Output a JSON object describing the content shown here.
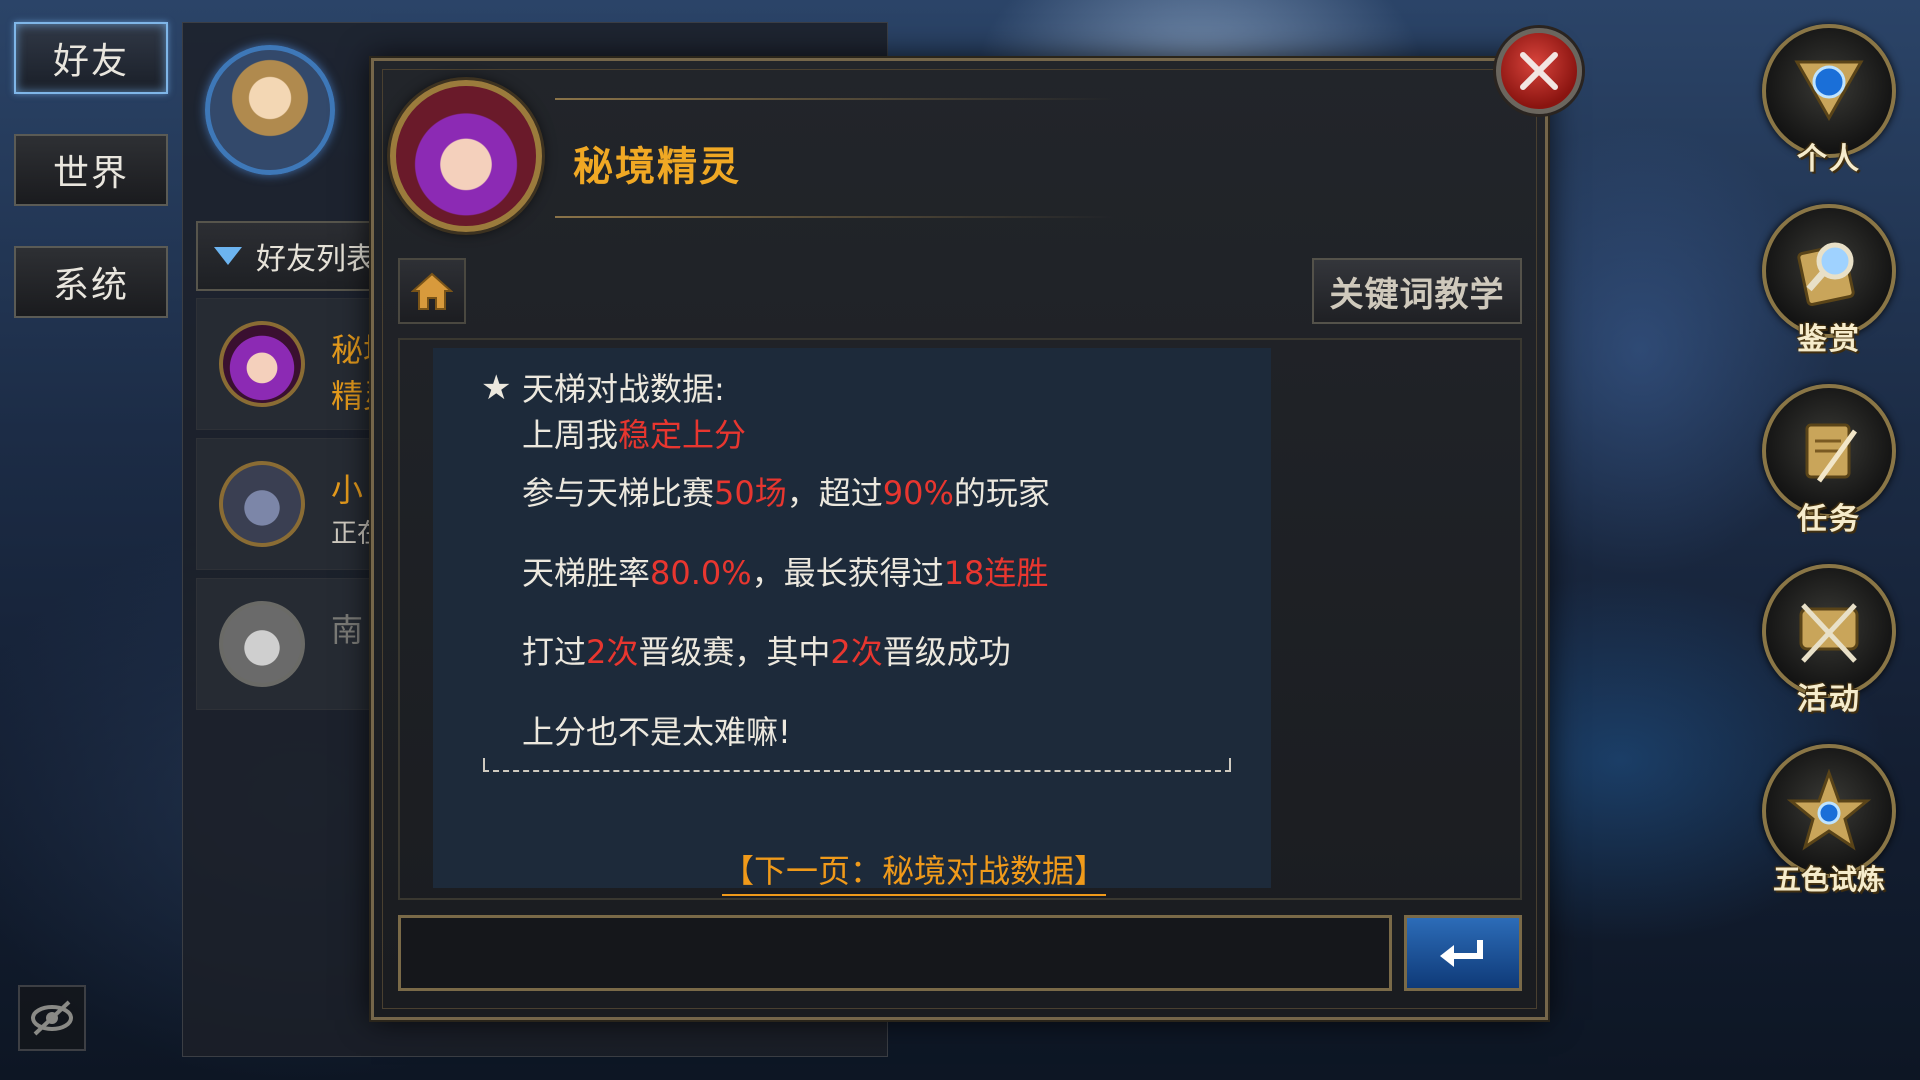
{
  "left_tabs": [
    {
      "label": "好友",
      "active": true
    },
    {
      "label": "世界",
      "active": false
    },
    {
      "label": "系统",
      "active": false
    }
  ],
  "friend_panel": {
    "list_header": "好友列表",
    "rows": [
      {
        "name": "秘境精灵",
        "sub": ""
      },
      {
        "name": "小",
        "sub": "正在"
      },
      {
        "name": "南",
        "sub": ""
      }
    ]
  },
  "dialog": {
    "npc_name": "秘境精灵",
    "keyword_button": "关键词教学",
    "message": {
      "star": "★",
      "title": "天梯对战数据:",
      "l1_a": "上周我",
      "l1_b": "稳定上分",
      "l2_a": "参与天梯比赛",
      "l2_b": "50场",
      "l2_c": "，超过",
      "l2_d": "90%",
      "l2_e": "的玩家",
      "l3_a": "天梯胜率",
      "l3_b": "80.0%",
      "l3_c": "，最长获得过",
      "l3_d": "18连胜",
      "l4_a": "打过",
      "l4_b": "2次",
      "l4_c": "晋级赛，其中",
      "l4_d": "2次",
      "l4_e": "晋级成功",
      "l5": "上分也不是太难嘛!"
    },
    "next_link": "【下一页：秘境对战数据】",
    "input_value": "",
    "input_placeholder": ""
  },
  "right_menu": [
    {
      "label": "个人",
      "icon": "eye-gem-icon"
    },
    {
      "label": "鉴赏",
      "icon": "magnifier-icon"
    },
    {
      "label": "任务",
      "icon": "scroll-quill-icon"
    },
    {
      "label": "活动",
      "icon": "scroll-sword-icon"
    },
    {
      "label": "五色试炼",
      "icon": "star-medal-icon"
    }
  ],
  "colors": {
    "accent_orange": "#f0a824",
    "highlight_red": "#e8362f",
    "frame_gold": "#7a6a48",
    "send_blue": "#1f58a0"
  }
}
